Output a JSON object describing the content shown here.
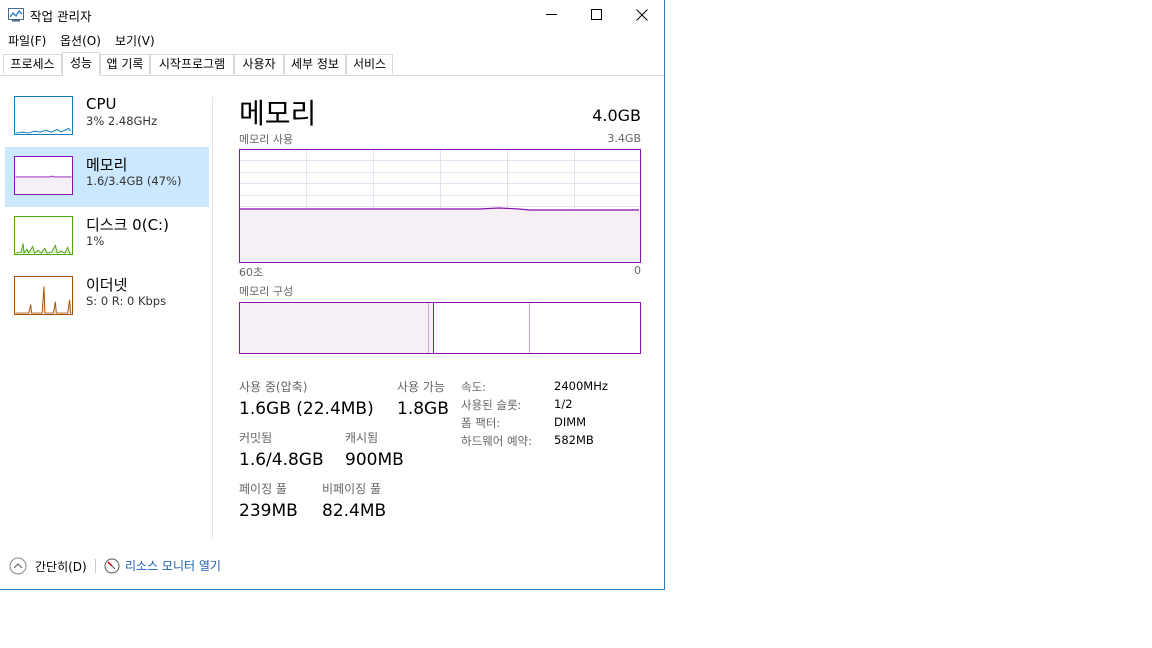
{
  "window": {
    "title": "작업 관리자",
    "minimize_icon": "minimize-icon",
    "maximize_icon": "maximize-icon",
    "close_icon": "close-icon"
  },
  "menu": [
    "파일(F)",
    "옵션(O)",
    "보기(V)"
  ],
  "tabs": [
    "프로세스",
    "성능",
    "앱 기록",
    "시작프로그램",
    "사용자",
    "세부 정보",
    "서비스"
  ],
  "active_tab": "성능",
  "sidebar": [
    {
      "name": "CPU",
      "sub": "3% 2.48GHz",
      "color": "#117dbb"
    },
    {
      "name": "메모리",
      "sub": "1.6/3.4GB (47%)",
      "color": "#8b12ae"
    },
    {
      "name": "디스크 0(C:)",
      "sub": "1%",
      "color": "#4da60c"
    },
    {
      "name": "이더넷",
      "sub": "S: 0 R: 0 Kbps",
      "color": "#a74f01"
    }
  ],
  "main": {
    "title": "메모리",
    "total": "4.0GB",
    "usage_label": "메모리 사용",
    "usage_max": "3.4GB",
    "time_left": "60초",
    "time_right": "0",
    "composition_label": "메모리 구성",
    "accent": "#8b12ae",
    "usage_level": 0.47
  },
  "stats": {
    "in_use_label": "사용 중(압축)",
    "in_use_value": "1.6GB (22.4MB)",
    "available_label": "사용 가능",
    "available_value": "1.8GB",
    "committed_label": "커밋됨",
    "committed_value": "1.6/4.8GB",
    "cached_label": "캐시됨",
    "cached_value": "900MB",
    "paged_label": "페이징 풀",
    "paged_value": "239MB",
    "nonpaged_label": "비페이징 풀",
    "nonpaged_value": "82.4MB"
  },
  "details": [
    {
      "label": "속도:",
      "value": "2400MHz"
    },
    {
      "label": "사용된 슬롯:",
      "value": "1/2"
    },
    {
      "label": "폼 팩터:",
      "value": "DIMM"
    },
    {
      "label": "하드웨어 예약:",
      "value": "582MB"
    }
  ],
  "footer": {
    "fewer_details": "간단히(D)",
    "resource_monitor": "리소스 모니터 열기"
  }
}
